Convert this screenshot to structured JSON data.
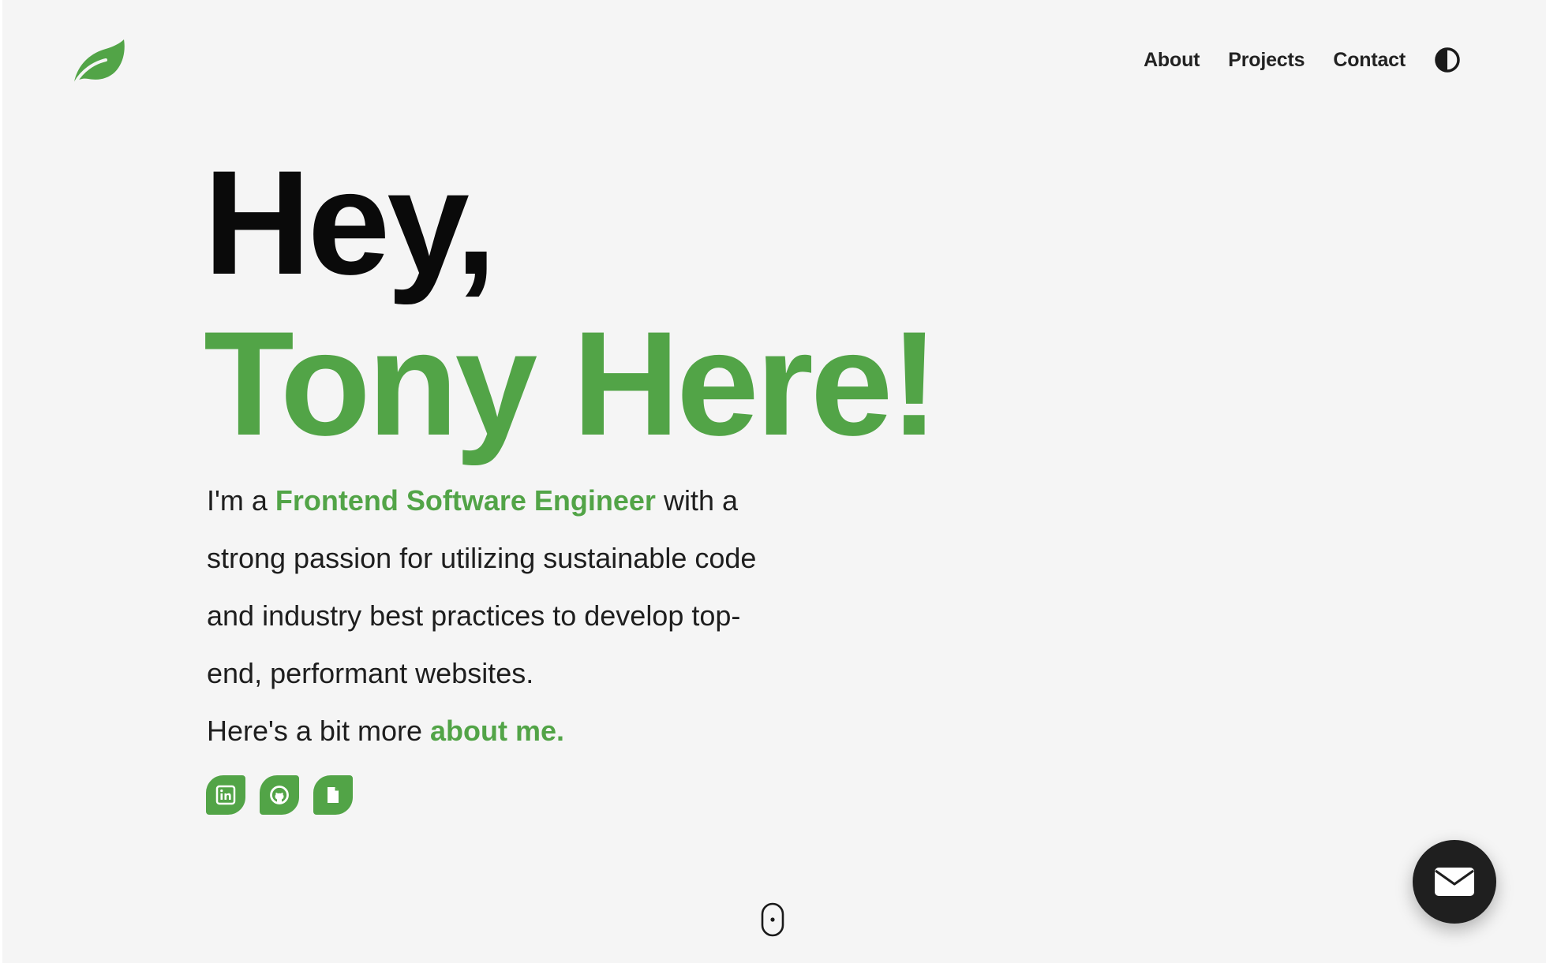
{
  "header": {
    "logo_icon": "leaf-icon",
    "nav": [
      {
        "label": "About"
      },
      {
        "label": "Projects"
      },
      {
        "label": "Contact"
      }
    ],
    "theme_toggle_icon": "contrast-icon"
  },
  "hero": {
    "greeting": "Hey,",
    "name_line": "Tony Here!",
    "intro_prefix": "I'm a ",
    "intro_role": "Frontend Software Engineer",
    "intro_body": " with a strong passion for utilizing sustainable code and industry best practices to develop top-end, performant websites.",
    "more_prefix": "Here's a bit more ",
    "more_link": "about me."
  },
  "socials": [
    {
      "icon": "linkedin-icon"
    },
    {
      "icon": "github-icon"
    },
    {
      "icon": "document-icon"
    }
  ],
  "scroll_indicator_icon": "mouse-scroll-icon",
  "fab_icon": "mail-icon",
  "colors": {
    "accent": "#52a447",
    "background": "#f5f5f5",
    "text": "#0a0a0a",
    "fab": "#1f1f1f"
  }
}
